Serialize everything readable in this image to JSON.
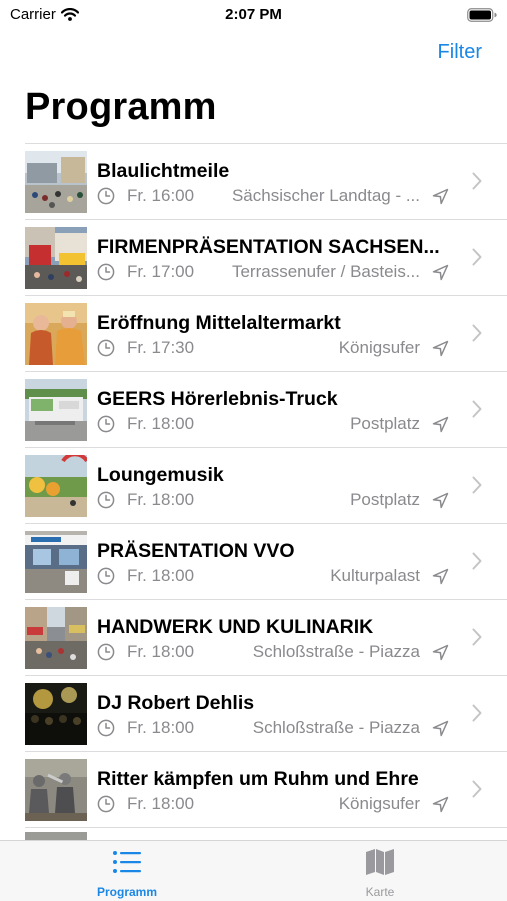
{
  "status_bar": {
    "carrier": "Carrier",
    "time": "2:07 PM"
  },
  "nav": {
    "filter_label": "Filter",
    "title": "Programm"
  },
  "events": [
    {
      "title": "Blaulichtmeile",
      "time": "Fr. 16:00",
      "location": "Sächsischer Landtag - ...",
      "thumbnail": "street-crowd"
    },
    {
      "title": "FIRMENPRÄSENTATION SACHSEN...",
      "time": "Fr. 17:00",
      "location": "Terrassenufer / Basteis...",
      "thumbnail": "fair-stand"
    },
    {
      "title": "Eröffnung Mittelaltermarkt",
      "time": "Fr. 17:30",
      "location": "Königsufer",
      "thumbnail": "medieval-performers"
    },
    {
      "title": "GEERS Hörerlebnis-Truck",
      "time": "Fr. 18:00",
      "location": "Postplatz",
      "thumbnail": "truck"
    },
    {
      "title": "Loungemusik",
      "time": "Fr. 18:00",
      "location": "Postplatz",
      "thumbnail": "lounge"
    },
    {
      "title": "PRÄSENTATION VVO",
      "time": "Fr. 18:00",
      "location": "Kulturpalast",
      "thumbnail": "booth"
    },
    {
      "title": "HANDWERK UND KULINARIK",
      "time": "Fr. 18:00",
      "location": "Schloßstraße - Piazza",
      "thumbnail": "market-street"
    },
    {
      "title": "DJ Robert Dehlis",
      "time": "Fr. 18:00",
      "location": "Schloßstraße - Piazza",
      "thumbnail": "night-stage"
    },
    {
      "title": "Ritter kämpfen um Ruhm und Ehre",
      "time": "Fr. 18:00",
      "location": "Königsufer",
      "thumbnail": "knights"
    }
  ],
  "tab_bar": {
    "tabs": [
      {
        "label": "Programm",
        "icon": "list-icon",
        "selected": true
      },
      {
        "label": "Karte",
        "icon": "map-icon",
        "selected": false
      }
    ]
  },
  "colors": {
    "accent": "#1a87e6",
    "secondary_text": "#8a8a8e",
    "tab_inactive": "#9a9a9e"
  }
}
